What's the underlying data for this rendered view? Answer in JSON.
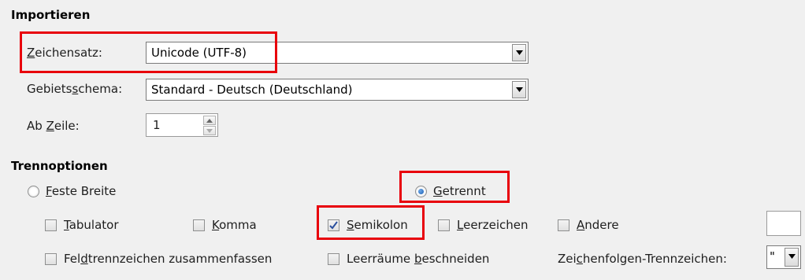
{
  "import": {
    "title": "Importieren",
    "charset": {
      "label_pre": "",
      "label_u": "Z",
      "label_post": "eichensatz:",
      "value": "Unicode (UTF-8)"
    },
    "locale": {
      "label_pre": "Gebiets",
      "label_u": "s",
      "label_post": "chema:",
      "value": "Standard - Deutsch (Deutschland)"
    },
    "from_row": {
      "label_pre": "Ab ",
      "label_u": "Z",
      "label_post": "eile:",
      "value": "1"
    }
  },
  "separator": {
    "title": "Trennoptionen",
    "fixed_width": {
      "label_pre": "",
      "label_u": "F",
      "label_post": "este Breite",
      "selected": false
    },
    "separated": {
      "label_pre": "",
      "label_u": "G",
      "label_post": "etrennt",
      "selected": true
    },
    "tab": {
      "label_pre": "",
      "label_u": "T",
      "label_post": "abulator",
      "checked": false
    },
    "comma": {
      "label_pre": "",
      "label_u": "K",
      "label_post": "omma",
      "checked": false
    },
    "semicolon": {
      "label_pre": "",
      "label_u": "S",
      "label_post": "emikolon",
      "checked": true
    },
    "space": {
      "label_pre": "",
      "label_u": "L",
      "label_post": "eerzeichen",
      "checked": false
    },
    "other": {
      "label_pre": "",
      "label_u": "A",
      "label_post": "ndere",
      "checked": false
    },
    "merge": {
      "label_pre": "Fel",
      "label_u": "d",
      "label_post": "trennzeichen zusammenfassen",
      "checked": false
    },
    "trim": {
      "label_pre": "Leerräume ",
      "label_u": "b",
      "label_post": "eschneiden",
      "checked": false
    },
    "string_delim": {
      "label_pre": "Zei",
      "label_u": "c",
      "label_post": "henfolgen-Trennzeichen:",
      "value": "\""
    }
  },
  "highlight_color": "#e8000b"
}
